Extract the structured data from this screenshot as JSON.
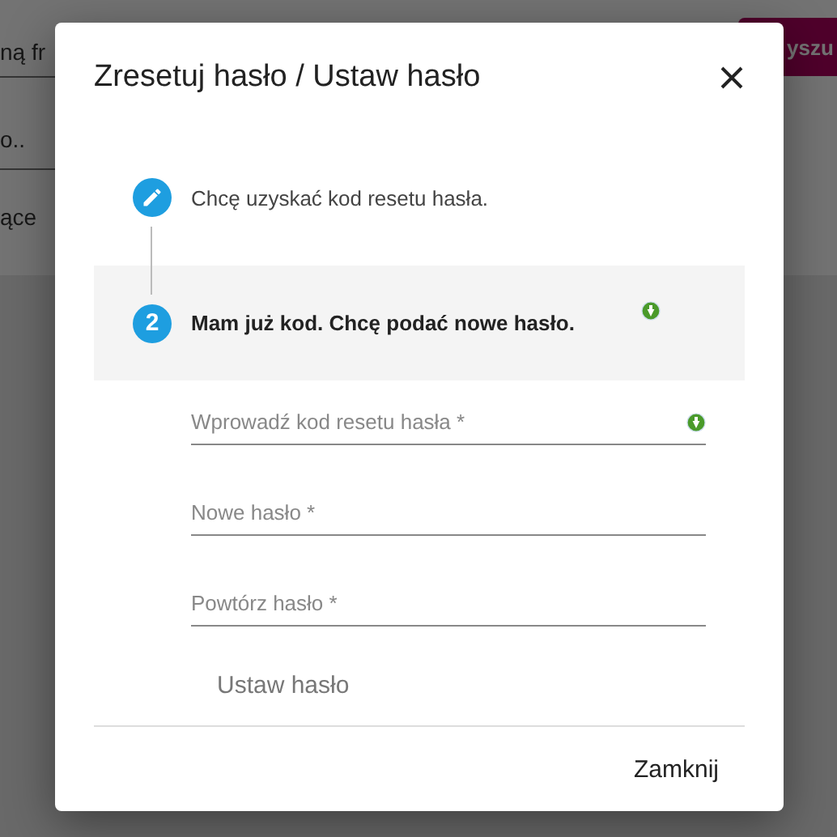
{
  "background": {
    "search_placeholder": "ną fr",
    "field_text": "o..",
    "text": "ące",
    "button": "yszu"
  },
  "dialog": {
    "title": "Zresetuj hasło / Ustaw hasło",
    "steps": [
      {
        "kind": "edit",
        "label": "Chcę uzyskać kod resetu hasła.",
        "active": false,
        "badge": false
      },
      {
        "kind": "number",
        "number": "2",
        "label": "Mam już kod. Chcę podać nowe hasło.",
        "active": true,
        "badge": true
      }
    ],
    "fields": [
      {
        "placeholder": "Wprowadź kod resetu hasła *",
        "badge": true
      },
      {
        "placeholder": "Nowe hasło *",
        "badge": false
      },
      {
        "placeholder": "Powtórz hasło *",
        "badge": false
      }
    ],
    "submit": {
      "label": "Ustaw hasło",
      "disabled": true
    },
    "close": "Zamknij"
  }
}
